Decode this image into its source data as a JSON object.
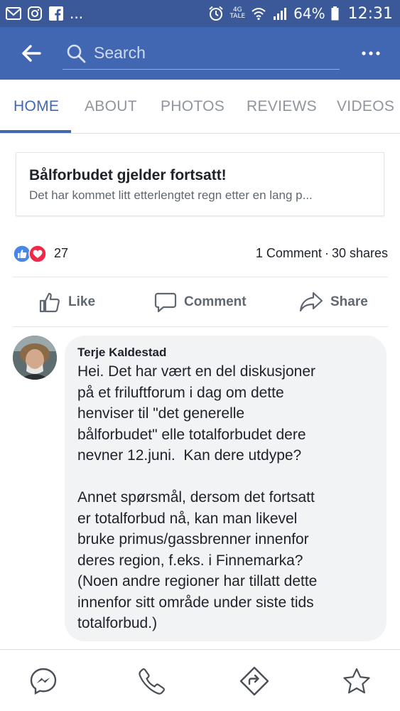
{
  "status_bar": {
    "icons": [
      "mail-icon",
      "instagram-icon",
      "facebook-icon",
      "alarm-icon",
      "wifi-icon",
      "signal-icon",
      "battery-icon"
    ],
    "ellipsis": "...",
    "network": "4G",
    "network_sub": "TALE",
    "battery": "64%",
    "time": "12:31"
  },
  "header": {
    "search_placeholder": "Search",
    "accent": "#4267b2",
    "status_bg": "#3b5998"
  },
  "tabs": [
    {
      "label": "HOME",
      "active": true
    },
    {
      "label": "ABOUT",
      "active": false
    },
    {
      "label": "PHOTOS",
      "active": false
    },
    {
      "label": "REVIEWS",
      "active": false
    },
    {
      "label": "VIDEOS",
      "active": false
    }
  ],
  "link_card": {
    "title": "Bålforbudet gjelder fortsatt!",
    "description": "Det har kommet litt etterlengtet regn etter en lang p..."
  },
  "reactions": {
    "icons": [
      "like-reaction-icon",
      "love-reaction-icon"
    ],
    "count": "27",
    "comments": "1 Comment",
    "separator": "·",
    "shares": "30 shares"
  },
  "actions": {
    "like": "Like",
    "comment": "Comment",
    "share": "Share"
  },
  "comment": {
    "author": "Terje Kaldestad",
    "text": "Hei. Det har vært en del diskusjoner\npå et friluftforum i dag om dette\nhenviser til \"det generelle\nbålforbudet\" elle totalforbudet dere\nnevner 12.juni.  Kan dere utdype?\n\nAnnet spørsmål, dersom det fortsatt\ner totalforbud nå, kan man likevel\nbruke primus/gassbrenner innenfor\nderes region, f.eks. i Finnemarka?\n(Noen andre regioner har tillatt dette\ninnenfor sitt område under siste tids\ntotalforbud.)"
  },
  "bottom_nav": [
    "messenger-icon",
    "phone-icon",
    "directions-icon",
    "star-icon"
  ]
}
